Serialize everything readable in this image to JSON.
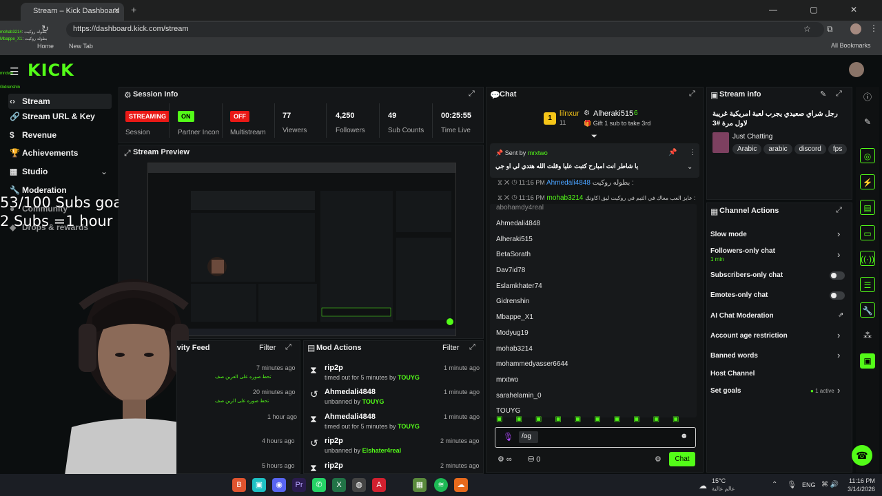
{
  "browser": {
    "tab_title": "Stream – Kick Dashboard",
    "tab_close": "✕",
    "new_tab_icon": "+",
    "window_controls": "— ▢ ✕",
    "url": "https://dashboard.kick.com/stream",
    "bookmarks": {
      "home": "Home",
      "new_tab": "New Tab",
      "all": "All Bookmarks"
    }
  },
  "header": {
    "logo": "KICK"
  },
  "sidebar": {
    "items": [
      {
        "label": "Stream",
        "icon": "‹›"
      },
      {
        "label": "Stream URL & Key",
        "icon": "🔗"
      },
      {
        "label": "Revenue",
        "icon": "$"
      },
      {
        "label": "Achievements",
        "icon": "🏆"
      },
      {
        "label": "Studio",
        "icon": "▦"
      },
      {
        "label": "Moderation",
        "icon": "🔧"
      },
      {
        "label": "Community",
        "icon": "●"
      },
      {
        "label": "Drops & rewards",
        "icon": "◆"
      }
    ]
  },
  "overlay": {
    "goal_line1": "53/100 Subs goal",
    "goal_line2": "2 Subs =1 hour",
    "chat": [
      {
        "name": "mohab3214",
        "text": "بطوله روكيت"
      },
      {
        "name": "Mbappe_X1",
        "text": "بطوله روكيت"
      },
      {
        "name": "mrxtwo",
        "text": ""
      },
      {
        "name": "Gidrenshin",
        "text": ""
      }
    ]
  },
  "session": {
    "title": "Session Info",
    "streaming": {
      "badge": "STREAMING",
      "label": "Session"
    },
    "partner": {
      "badge": "ON",
      "label": "Partner Income"
    },
    "multistream": {
      "badge": "OFF",
      "label": "Multistream"
    },
    "viewers": {
      "value": "77",
      "label": "Viewers"
    },
    "followers": {
      "value": "4,250",
      "label": "Followers"
    },
    "subs": {
      "value": "49",
      "label": "Sub Counts"
    },
    "time": {
      "value": "00:25:55",
      "label": "Time Live"
    }
  },
  "preview": {
    "title": "Stream Preview"
  },
  "activity": {
    "title": "Activity Feed",
    "filter": "Filter",
    "items": [
      {
        "text": "تحط صوره على العرين صف",
        "time": "7 minutes ago"
      },
      {
        "text": "تحط صوره على الرين صف",
        "time": "20 minutes ago"
      },
      {
        "text": "",
        "time": "1 hour ago"
      },
      {
        "text": "",
        "time": "4 hours ago"
      },
      {
        "text": "",
        "time": "5 hours ago"
      }
    ]
  },
  "mod_actions": {
    "title": "Mod Actions",
    "filter": "Filter",
    "items": [
      {
        "user": "rip2p",
        "action": "timed out for 5 minutes by",
        "by": "TOUYG",
        "time": "1 minute ago",
        "icon": "⧗"
      },
      {
        "user": "Ahmedali4848",
        "action": "unbanned by",
        "by": "TOUYG",
        "time": "1 minute ago",
        "icon": "↺"
      },
      {
        "user": "Ahmedali4848",
        "action": "timed out for 5 minutes by",
        "by": "TOUYG",
        "time": "1 minute ago",
        "icon": "⧗"
      },
      {
        "user": "rip2p",
        "action": "unbanned by",
        "by": "Elshater4real",
        "time": "2 minutes ago",
        "icon": "↺"
      },
      {
        "user": "rip2p",
        "action": "",
        "by": "",
        "time": "2 minutes ago",
        "icon": "⧗"
      }
    ]
  },
  "chat": {
    "title": "Chat",
    "top_user": "lilnxur",
    "top_rank": "1",
    "top_count": "11",
    "gifter": "Alheraki515",
    "gifter_count": "6",
    "gift_text": "Gift 1 sub to take 3rd",
    "pinned_by_label": "Sent by",
    "pinned_by": "mrxtwo",
    "pinned_text": "يا شاطر انت امبارح كتبت عليا وقلت الله هتدي لي او جي",
    "messages": [
      {
        "time": "11:16 PM",
        "user": "Ahmedali4848",
        "text": "بطوله روكيت :",
        "color": "#4aa3ff"
      },
      {
        "time": "11:16 PM",
        "user": "mohab3214",
        "text": "عايز العب معاك في التيم في روكيت ليق اكاونك :",
        "color": "#53fc18"
      }
    ],
    "users_partial": "abohamdy4real",
    "users": [
      "Ahmedali4848",
      "Alheraki515",
      "BetaSorath",
      "Dav7id78",
      "Eslamkhater74",
      "Gidrenshin",
      "Mbappe_X1",
      "Modyug19",
      "mohab3214",
      "mohammedyasser6644",
      "mrxtwo",
      "sarahelamin_0",
      "TOUYG"
    ],
    "input_value": "/og",
    "points": "0",
    "send": "Chat"
  },
  "stream_info": {
    "title": "Stream info",
    "stream_title": "رجل شراي صعيدي يجرب لعبة امريكية غريبة لاول مرة #3",
    "category": "Just Chatting",
    "tags": [
      "Arabic",
      "arabic",
      "discord",
      "fps"
    ]
  },
  "channel_actions": {
    "title": "Channel Actions",
    "items": [
      {
        "label": "Slow mode",
        "kind": "chevron"
      },
      {
        "label": "Followers-only chat",
        "sub": "1 min",
        "kind": "chevron"
      },
      {
        "label": "Subscribers-only chat",
        "kind": "toggle"
      },
      {
        "label": "Emotes-only chat",
        "kind": "toggle"
      },
      {
        "label": "AI Chat Moderation",
        "kind": "link"
      },
      {
        "label": "Account age restriction",
        "kind": "chevron"
      },
      {
        "label": "Banned words",
        "kind": "chevron"
      },
      {
        "label": "Host Channel",
        "kind": "none"
      },
      {
        "label": "Set goals",
        "sub": "1 active",
        "kind": "chevron"
      }
    ]
  },
  "taskbar": {
    "weather_temp": "15°C",
    "weather_desc": "عالم عالية",
    "lang": "ENG",
    "time": "11:16 PM",
    "date": "3/14/2026"
  },
  "colors": {
    "accent": "#53fc18",
    "streaming_red": "#e91916",
    "panel_bg": "#141618"
  }
}
